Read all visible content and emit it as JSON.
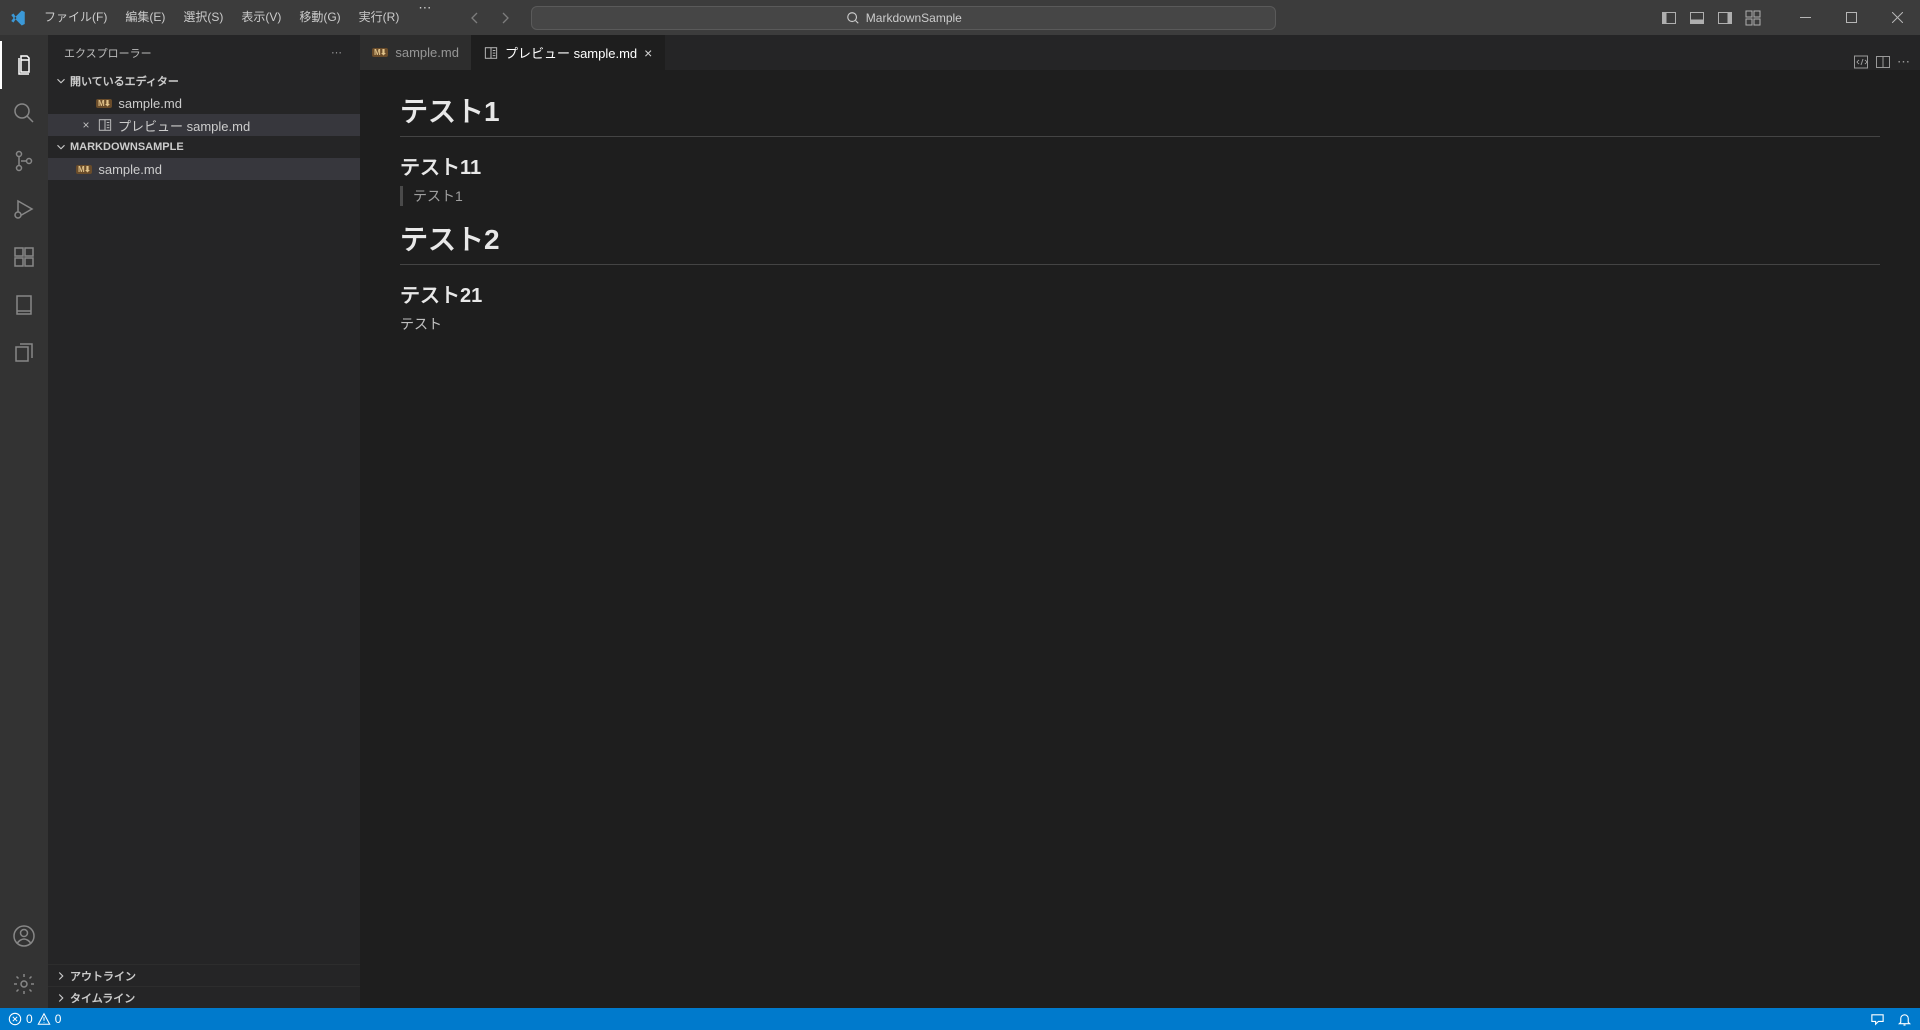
{
  "menu": {
    "items": [
      "ファイル(F)",
      "編集(E)",
      "選択(S)",
      "表示(V)",
      "移動(G)",
      "実行(R)"
    ]
  },
  "search": {
    "text": "MarkdownSample"
  },
  "sidebar": {
    "title": "エクスプローラー",
    "openEditors": {
      "label": "開いているエディター",
      "items": [
        {
          "name": "sample.md",
          "isPreview": false,
          "dirty": false
        },
        {
          "name": "プレビュー sample.md",
          "isPreview": true,
          "dirty": true
        }
      ]
    },
    "workspace": {
      "label": "MARKDOWNSAMPLE",
      "files": [
        {
          "name": "sample.md"
        }
      ]
    },
    "outline": "アウトライン",
    "timeline": "タイムライン"
  },
  "tabs": {
    "items": [
      {
        "label": "sample.md",
        "active": false,
        "isPreview": false
      },
      {
        "label": "プレビュー sample.md",
        "active": true,
        "isPreview": true
      }
    ]
  },
  "preview": {
    "h1a": "テスト1",
    "h2a": "テスト11",
    "bq": "テスト1",
    "h1b": "テスト2",
    "h2b": "テスト21",
    "p": "テスト"
  },
  "status": {
    "errors": "0",
    "warnings": "0"
  }
}
